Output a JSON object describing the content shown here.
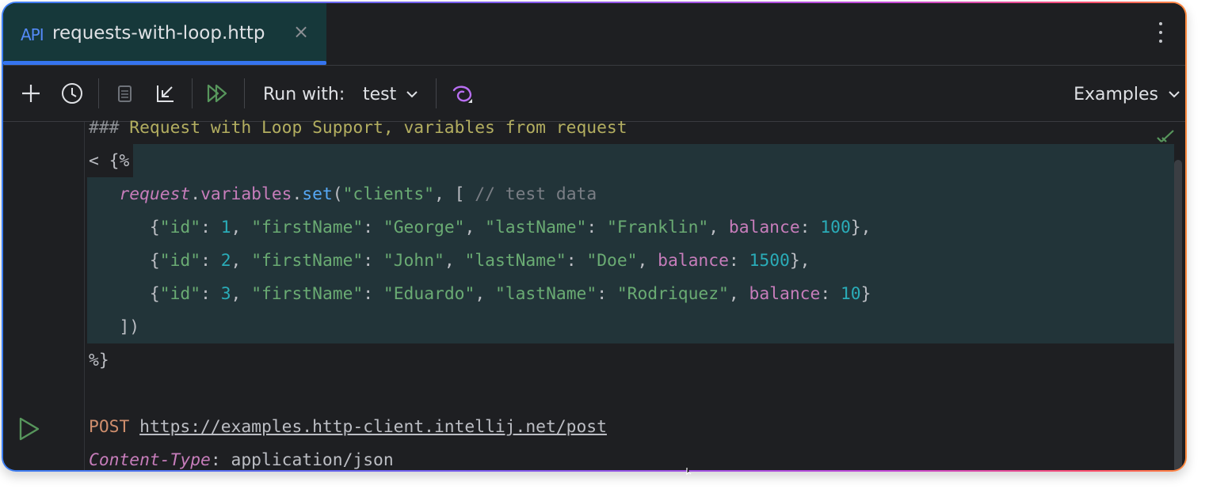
{
  "tab": {
    "icon": "API",
    "title": "requests-with-loop.http",
    "close": "×"
  },
  "toolbar": {
    "add_icon": "plus-icon",
    "history_icon": "clock-icon",
    "copy_icon": "copy-icon",
    "import_icon": "import-arrow-icon",
    "run_all_icon": "run-all-icon",
    "run_with_label": "Run with:",
    "environment": "test",
    "http_client_icon": "spiral-icon",
    "examples_label": "Examples"
  },
  "code": {
    "title_prefix": "###",
    "title_text": " Request with Loop Support, variables from request",
    "open_script": "< {%",
    "line_request_obj": "request",
    "line_dot1": ".",
    "line_variables": "variables",
    "line_dot2": ".",
    "line_set": "set",
    "line_paren_open": "(",
    "line_clients": "\"clients\"",
    "line_comma_bracket": ", [ ",
    "line_comment": "// test data",
    "rows": [
      {
        "id": "1",
        "first": "\"George\"",
        "last": "\"Franklin\"",
        "balance": "100",
        "end": "},"
      },
      {
        "id": "2",
        "first": "\"John\"",
        "last": "\"Doe\"",
        "balance": "1500",
        "end": "},"
      },
      {
        "id": "3",
        "first": "\"Eduardo\"",
        "last": "\"Rodriquez\"",
        "balance": "10",
        "end": "}"
      }
    ],
    "close_bracket": "])",
    "close_script": "%}",
    "method": "POST",
    "url": "https://examples.http-client.intellij.net/post",
    "header_name": "Content-Type",
    "header_value": "application/json"
  },
  "colors": {
    "accent": "#3574f0",
    "highlight": "#223439"
  }
}
